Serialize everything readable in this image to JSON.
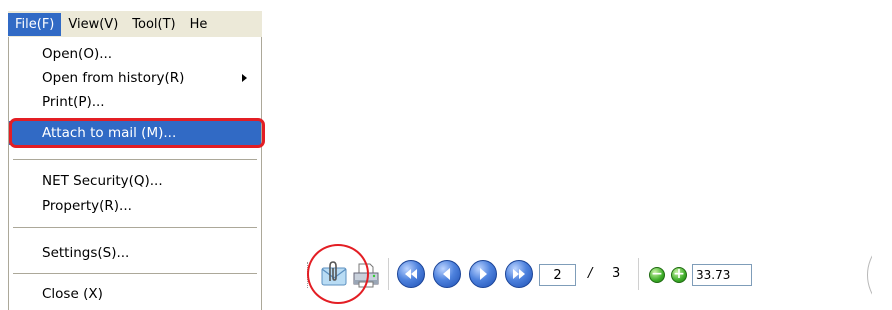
{
  "menubar": {
    "items": [
      "File(F)",
      "View(V)",
      "Tool(T)",
      "He"
    ]
  },
  "file_menu": {
    "items": [
      {
        "label": "Open(O)..."
      },
      {
        "label": "Open from history(R)"
      },
      {
        "label": "Print(P)..."
      },
      {
        "label": "Attach to mail (M)..."
      },
      {
        "label": "NET Security(Q)..."
      },
      {
        "label": "Property(R)..."
      },
      {
        "label": "Settings(S)..."
      },
      {
        "label": "Close (X)"
      }
    ],
    "highlighted_item": "Attach to mail (M)..."
  },
  "toolbar": {
    "buttons": [
      "attach-mail-icon",
      "print-icon",
      "first-page-icon",
      "previous-page-icon",
      "next-page-icon",
      "last-page-icon",
      "zoom-out-icon",
      "zoom-in-icon"
    ],
    "page_current": "2",
    "page_separator": "/",
    "page_total": "3",
    "zoom_value": "33.73"
  },
  "colors": {
    "highlight": "#316ac5",
    "callout": "#e31e24",
    "menubar_bg": "#ece9d8"
  }
}
